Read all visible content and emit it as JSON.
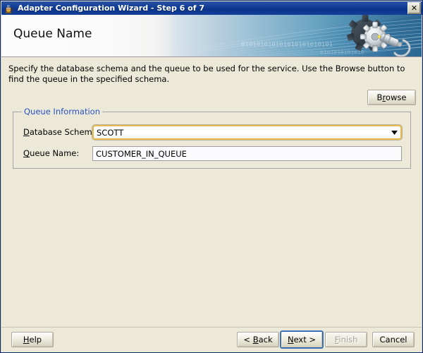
{
  "window": {
    "title": "Adapter Configuration Wizard - Step 6 of 7",
    "icon": "coffee-cup-icon",
    "close_label": "✕"
  },
  "banner": {
    "heading": "Queue Name",
    "binary_text": "010101010101010101010101",
    "binary_text_2": "0101010101010",
    "graphic": "gear-cable-icon"
  },
  "main": {
    "description": "Specify the database schema and the queue to be used for the service. Use the Browse button to find the queue in the specified schema.",
    "browse_button": {
      "label": "Browse",
      "mnemonic": "r"
    },
    "group": {
      "legend": "Queue Information",
      "fields": [
        {
          "name": "database-schema",
          "label": "Database Schema:",
          "mnemonic": "D",
          "type": "combobox",
          "value": "SCOTT"
        },
        {
          "name": "queue-name",
          "label": "Queue Name:",
          "mnemonic": "Q",
          "type": "text",
          "value": "CUSTOMER_IN_QUEUE",
          "placeholder": ""
        }
      ]
    }
  },
  "footer": {
    "buttons": [
      {
        "name": "help",
        "label": "Help",
        "mnemonic": "H",
        "state": "enabled"
      },
      {
        "name": "back",
        "label": "< Back",
        "mnemonic": "B",
        "state": "enabled"
      },
      {
        "name": "next",
        "label": "Next >",
        "mnemonic": "N",
        "state": "focused"
      },
      {
        "name": "finish",
        "label": "Finish",
        "mnemonic": "F",
        "state": "disabled"
      },
      {
        "name": "cancel",
        "label": "Cancel",
        "mnemonic": "",
        "state": "enabled"
      }
    ]
  },
  "colors": {
    "titlebar": "#0b348c",
    "banner_blue": "#2a6690",
    "group_legend": "#2a53c1",
    "combo_border": "#e8b84b",
    "face": "#ece9d8",
    "focus_ring": "#2c5fa8"
  }
}
